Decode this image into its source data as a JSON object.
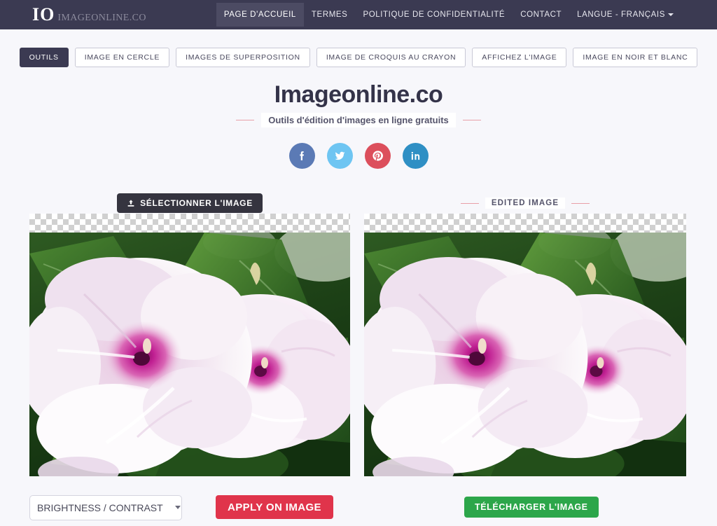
{
  "header": {
    "brand_mark": "IO",
    "brand_name": "IMAGEONLINE.CO",
    "nav": [
      {
        "label": "PAGE D'ACCUEIL",
        "active": true
      },
      {
        "label": "TERMES",
        "active": false
      },
      {
        "label": "POLITIQUE DE CONFIDENTIALITÉ",
        "active": false
      },
      {
        "label": "CONTACT",
        "active": false
      }
    ],
    "language_label": "LANGUE - FRANÇAIS",
    "caret_icon": "chevron-down-icon",
    "bg_color": "#3b3a52"
  },
  "toolbar": {
    "items": [
      {
        "label": "OUTILS",
        "active": true
      },
      {
        "label": "IMAGE EN CERCLE",
        "active": false
      },
      {
        "label": "IMAGES DE SUPERPOSITION",
        "active": false
      },
      {
        "label": "IMAGE DE CROQUIS AU CRAYON",
        "active": false
      },
      {
        "label": "AFFICHEZ L'IMAGE",
        "active": false
      },
      {
        "label": "IMAGE EN NOIR ET BLANC",
        "active": false
      }
    ]
  },
  "hero": {
    "title": "Imageonline.co",
    "subtitle": "Outils d'édition d'images en ligne gratuits",
    "accent_color": "#e8a0a8"
  },
  "social": [
    {
      "name": "facebook",
      "color": "#5b7ab5"
    },
    {
      "name": "twitter",
      "color": "#6ec5f2"
    },
    {
      "name": "pinterest",
      "color": "#dc4f5c"
    },
    {
      "name": "linkedin",
      "color": "#2f8fc4"
    }
  ],
  "editor": {
    "select_image_label": "SÉLECTIONNER L'IMAGE",
    "upload_icon": "upload-icon",
    "edited_image_label": "EDITED IMAGE",
    "source_image_alt": "Deux fleurs de liseron blanches et roses avec coeur magenta sur feuillage vert",
    "edited_image_alt": "Deux fleurs de liseron blanches et roses avec coeur magenta sur feuillage vert"
  },
  "controls": {
    "filter_selected": "BRIGHTNESS / CONTRAST",
    "filter_options": [
      "BRIGHTNESS / CONTRAST"
    ],
    "apply_label": "APPLY ON IMAGE",
    "apply_color": "#e0344b",
    "download_label": "TÉLÉCHARGER L'IMAGE",
    "download_color": "#2ca64a"
  }
}
